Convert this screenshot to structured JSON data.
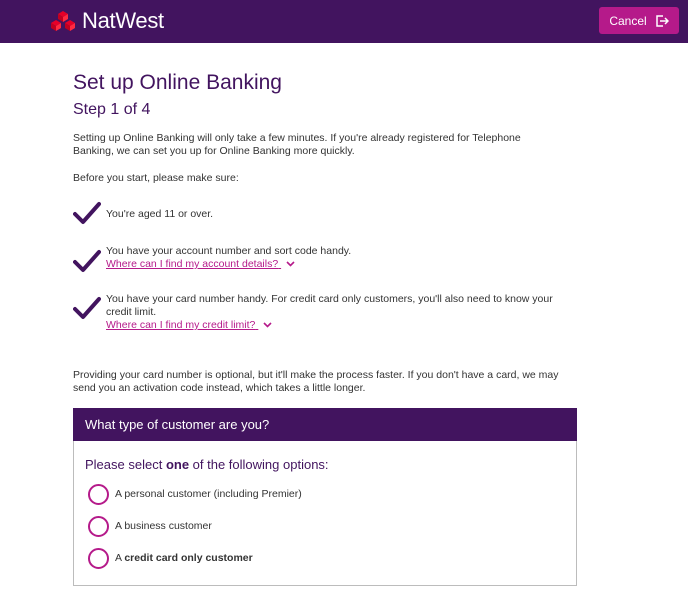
{
  "header": {
    "brand": "NatWest",
    "cancel_label": "Cancel",
    "colors": {
      "bar": "#42145f",
      "cancel": "#b51a8a",
      "logo": "#e60028"
    }
  },
  "page": {
    "title": "Set up Online Banking",
    "step": "Step 1 of 4",
    "intro": "Setting up Online Banking will only take a few minutes. If you're already registered for Telephone Banking, we can set you up for Online Banking more quickly.",
    "before": "Before you start, please make sure:",
    "checklist": [
      {
        "lines": [
          "You're aged 11 or over."
        ],
        "link": ""
      },
      {
        "lines": [
          "You have your account number and sort code handy."
        ],
        "link": "Where can I find my account details?"
      },
      {
        "lines": [
          "You have your card number handy. For credit card only customers, you'll also need to know your",
          "credit limit."
        ],
        "link": "Where can I find my credit limit?"
      }
    ],
    "outro": "Providing your card number is optional, but it'll make the process faster. If you don't have a card, we may send you an activation code instead, which takes a little longer."
  },
  "panel": {
    "heading": "What type of customer are you?",
    "prompt_before": "Please select ",
    "prompt_bold": "one",
    "prompt_after": " of the following options:",
    "options": [
      {
        "prefix": "A personal customer (including Premier)",
        "bold": ""
      },
      {
        "prefix": "A business customer",
        "bold": ""
      },
      {
        "prefix": "A ",
        "bold": "credit card only customer"
      }
    ]
  },
  "icons": {
    "logo": "natwest-cubes-icon",
    "cancel": "exit-icon",
    "check": "checkmark-icon",
    "expand": "chevron-down-icon",
    "radio": "radio-empty-icon"
  }
}
